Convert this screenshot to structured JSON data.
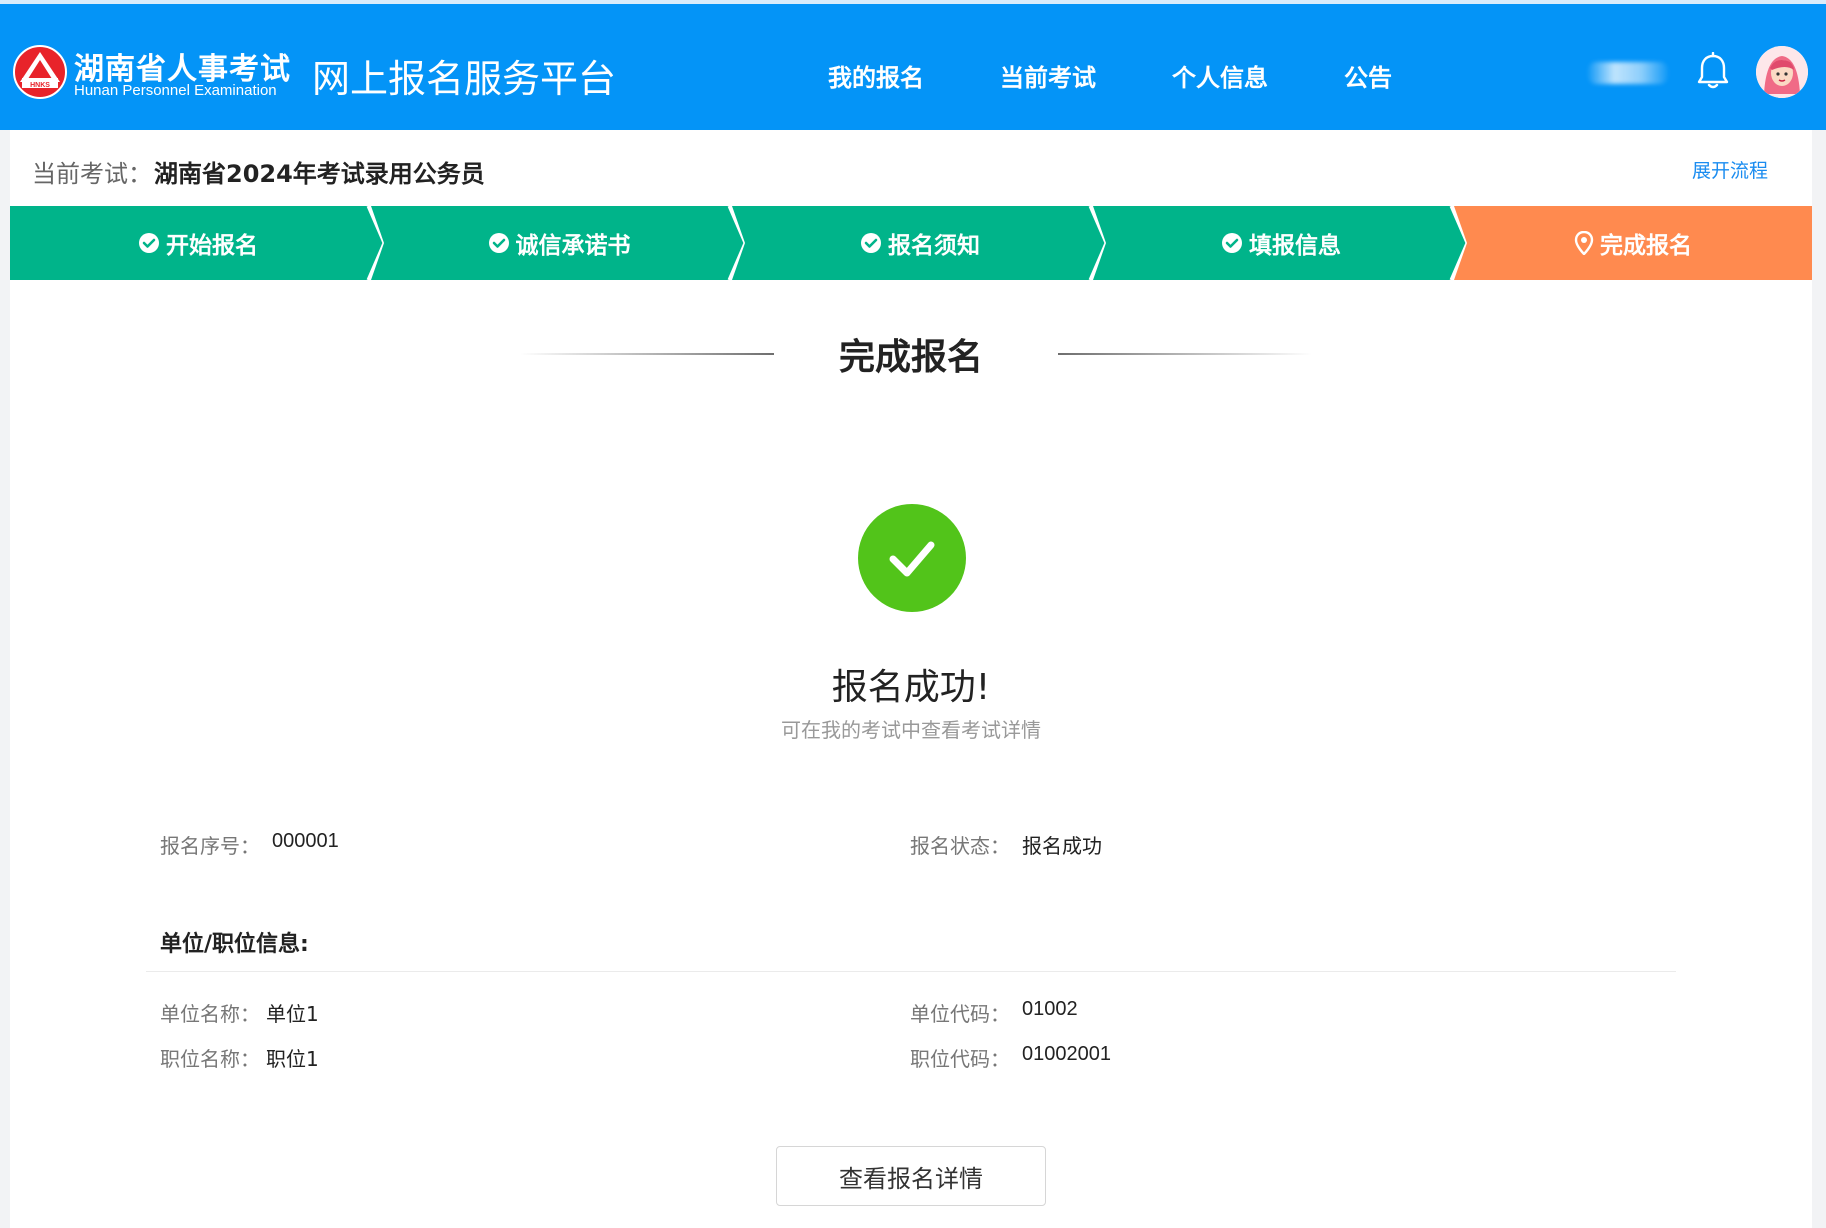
{
  "header": {
    "logo_cn": "湖南省人事考试",
    "logo_en": "Hunan Personnel Examination",
    "logo_badge": "HNKS",
    "platform_title": "网上报名服务平台",
    "nav": [
      {
        "label": "我的报名"
      },
      {
        "label": "当前考试"
      },
      {
        "label": "个人信息"
      },
      {
        "label": "公告"
      }
    ],
    "bell_icon": "bell-icon",
    "avatar_icon": "user-avatar"
  },
  "exam_bar": {
    "label": "当前考试：",
    "name": "湖南省2024年考试录用公务员",
    "expand_link": "展开流程"
  },
  "steps": [
    {
      "label": "开始报名",
      "status": "done",
      "icon": "check-circle-icon"
    },
    {
      "label": "诚信承诺书",
      "status": "done",
      "icon": "check-circle-icon"
    },
    {
      "label": "报名须知",
      "status": "done",
      "icon": "check-circle-icon"
    },
    {
      "label": "填报信息",
      "status": "done",
      "icon": "check-circle-icon"
    },
    {
      "label": "完成报名",
      "status": "current",
      "icon": "location-pin-icon"
    }
  ],
  "colors": {
    "header": "#0494f7",
    "step_done": "#00b48a",
    "step_current": "#ff8a4f",
    "success": "#52c41a",
    "link": "#1a8cf0"
  },
  "section_title": "完成报名",
  "result": {
    "icon": "success-check-icon",
    "title": "报名成功!",
    "subtitle": "可在我的考试中查看考试详情"
  },
  "registration": {
    "serial_label": "报名序号：",
    "serial_value": "000001",
    "status_label": "报名状态：",
    "status_value": "报名成功"
  },
  "unit_info": {
    "heading": "单位/职位信息:",
    "unit_name_label": "单位名称：",
    "unit_name_value": "单位1",
    "unit_code_label": "单位代码：",
    "unit_code_value": "01002",
    "position_name_label": "职位名称：",
    "position_name_value": "职位1",
    "position_code_label": "职位代码：",
    "position_code_value": "01002001"
  },
  "detail_button": "查看报名详情"
}
